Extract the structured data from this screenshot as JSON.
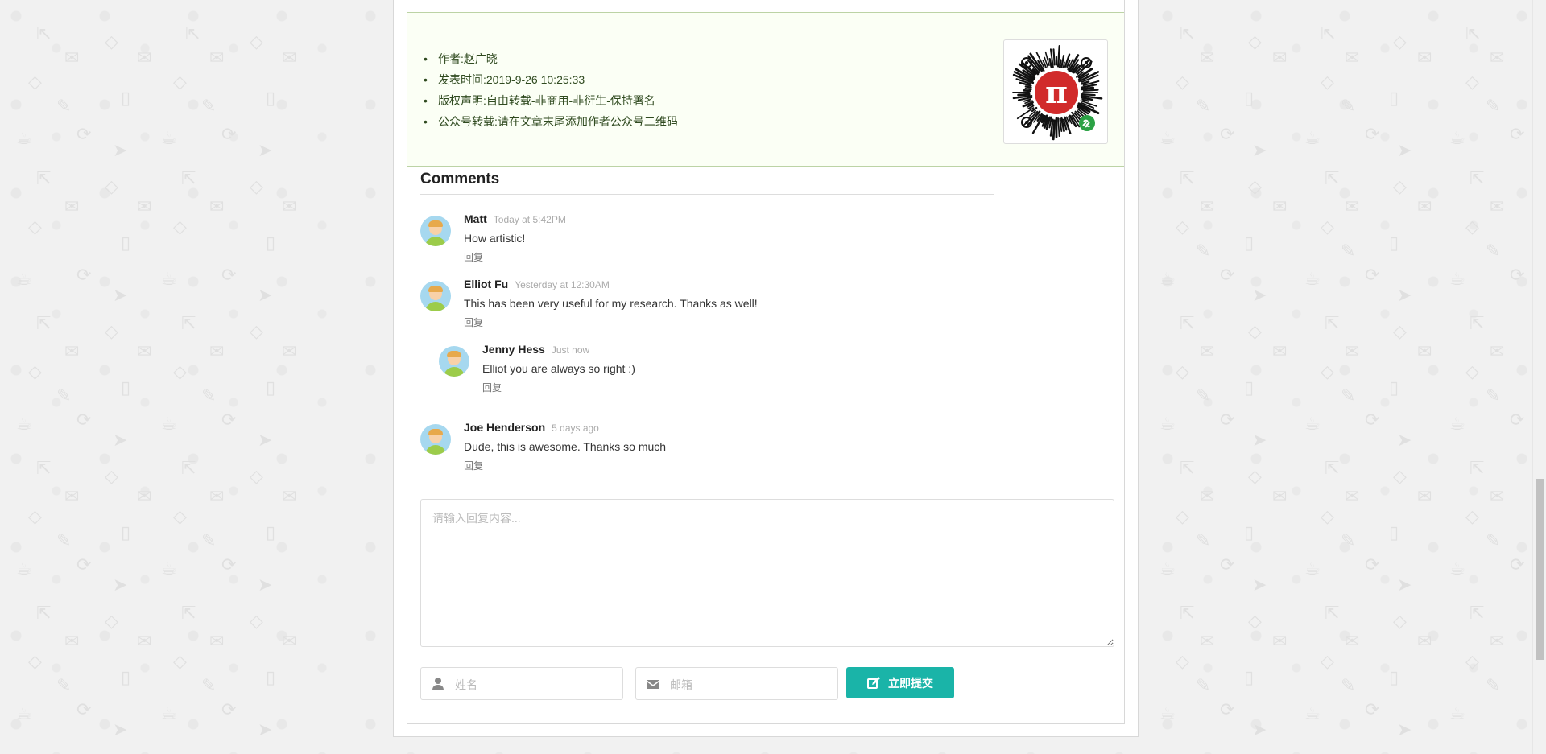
{
  "info": {
    "items": [
      "作者:赵广晓",
      "发表时间:2019-9-26 10:25:33",
      "版权声明:自由转载-非商用-非衍生-保持署名",
      "公众号转载:请在文章末尾添加作者公众号二维码"
    ],
    "qr_icon": "mini-program-qr-code",
    "qr_symbol": "π"
  },
  "comments": {
    "title": "Comments",
    "list": [
      {
        "author": "Matt",
        "time": "Today at 5:42PM",
        "text": "How artistic!",
        "reply": "回复"
      },
      {
        "author": "Elliot Fu",
        "time": "Yesterday at 12:30AM",
        "text": "This has been very useful for my research. Thanks as well!",
        "reply": "回复"
      },
      {
        "author": "Jenny Hess",
        "time": "Just now",
        "text": "Elliot you are always so right :)",
        "reply": "回复"
      },
      {
        "author": "Joe Henderson",
        "time": "5 days ago",
        "text": "Dude, this is awesome. Thanks so much",
        "reply": "回复"
      }
    ]
  },
  "form": {
    "content_placeholder": "请输入回复内容...",
    "name_placeholder": "姓名",
    "email_placeholder": "邮箱",
    "submit_label": "立即提交"
  },
  "colors": {
    "info_bg": "#fbfff5",
    "info_text": "#2f4a1f",
    "submit_bg": "#1ab4a8",
    "qr_red": "#d12b2b"
  }
}
